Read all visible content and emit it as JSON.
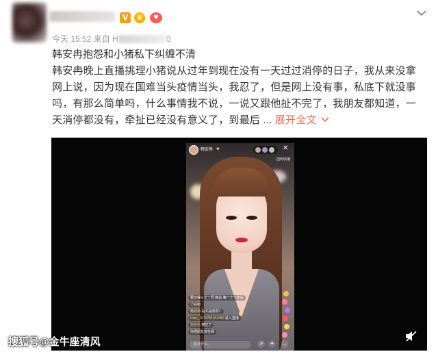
{
  "header": {
    "meta_prefix": "今天 15:52 来自 H",
    "meta_suffix": "0",
    "badges": {
      "v": "V",
      "crown": "♛",
      "heart": "♥"
    }
  },
  "post": {
    "title": "韩安冉抱怨和小猪私下纠缠不清",
    "content": "韩安冉晚上直播挑理小猪说从过年到现在没有一天过过消停的日子，我从来没拿网上说，因为现在国难当头疫情当头，我忍了，但是网上没有事，私底下就没事吗，有那么简单吗，什么事情我不说，一说又跟他扯不完了，我朋友都知道，一天消停都没有，牵扯已经没有意义了，到最后 ... ",
    "expand_label": "展开全文"
  },
  "video": {
    "live_ui": {
      "host_name": "韩安冉",
      "close": "✕",
      "sub_info": "回到快播",
      "chat": [
        {
          "user": "",
          "text": "要记得三十一号 韩总 第一个下家是"
        },
        {
          "user": "",
          "text": "了好吧"
        },
        {
          "user": "韩安冉:",
          "text": "是不是肉燕？"
        },
        {
          "user": "User_1579781041480",
          "text": "进入直播"
        },
        {
          "user": "刘光毛",
          "text": "撑住了"
        },
        {
          "user": "",
          "text": "你把朋友放在阁"
        }
      ],
      "say_placeholder": "说点什么..."
    }
  },
  "watermark": "搜狐号@金牛座清风",
  "colors": {
    "accent": "#eb7350",
    "text": "#333333",
    "meta": "#9a9a9a"
  }
}
